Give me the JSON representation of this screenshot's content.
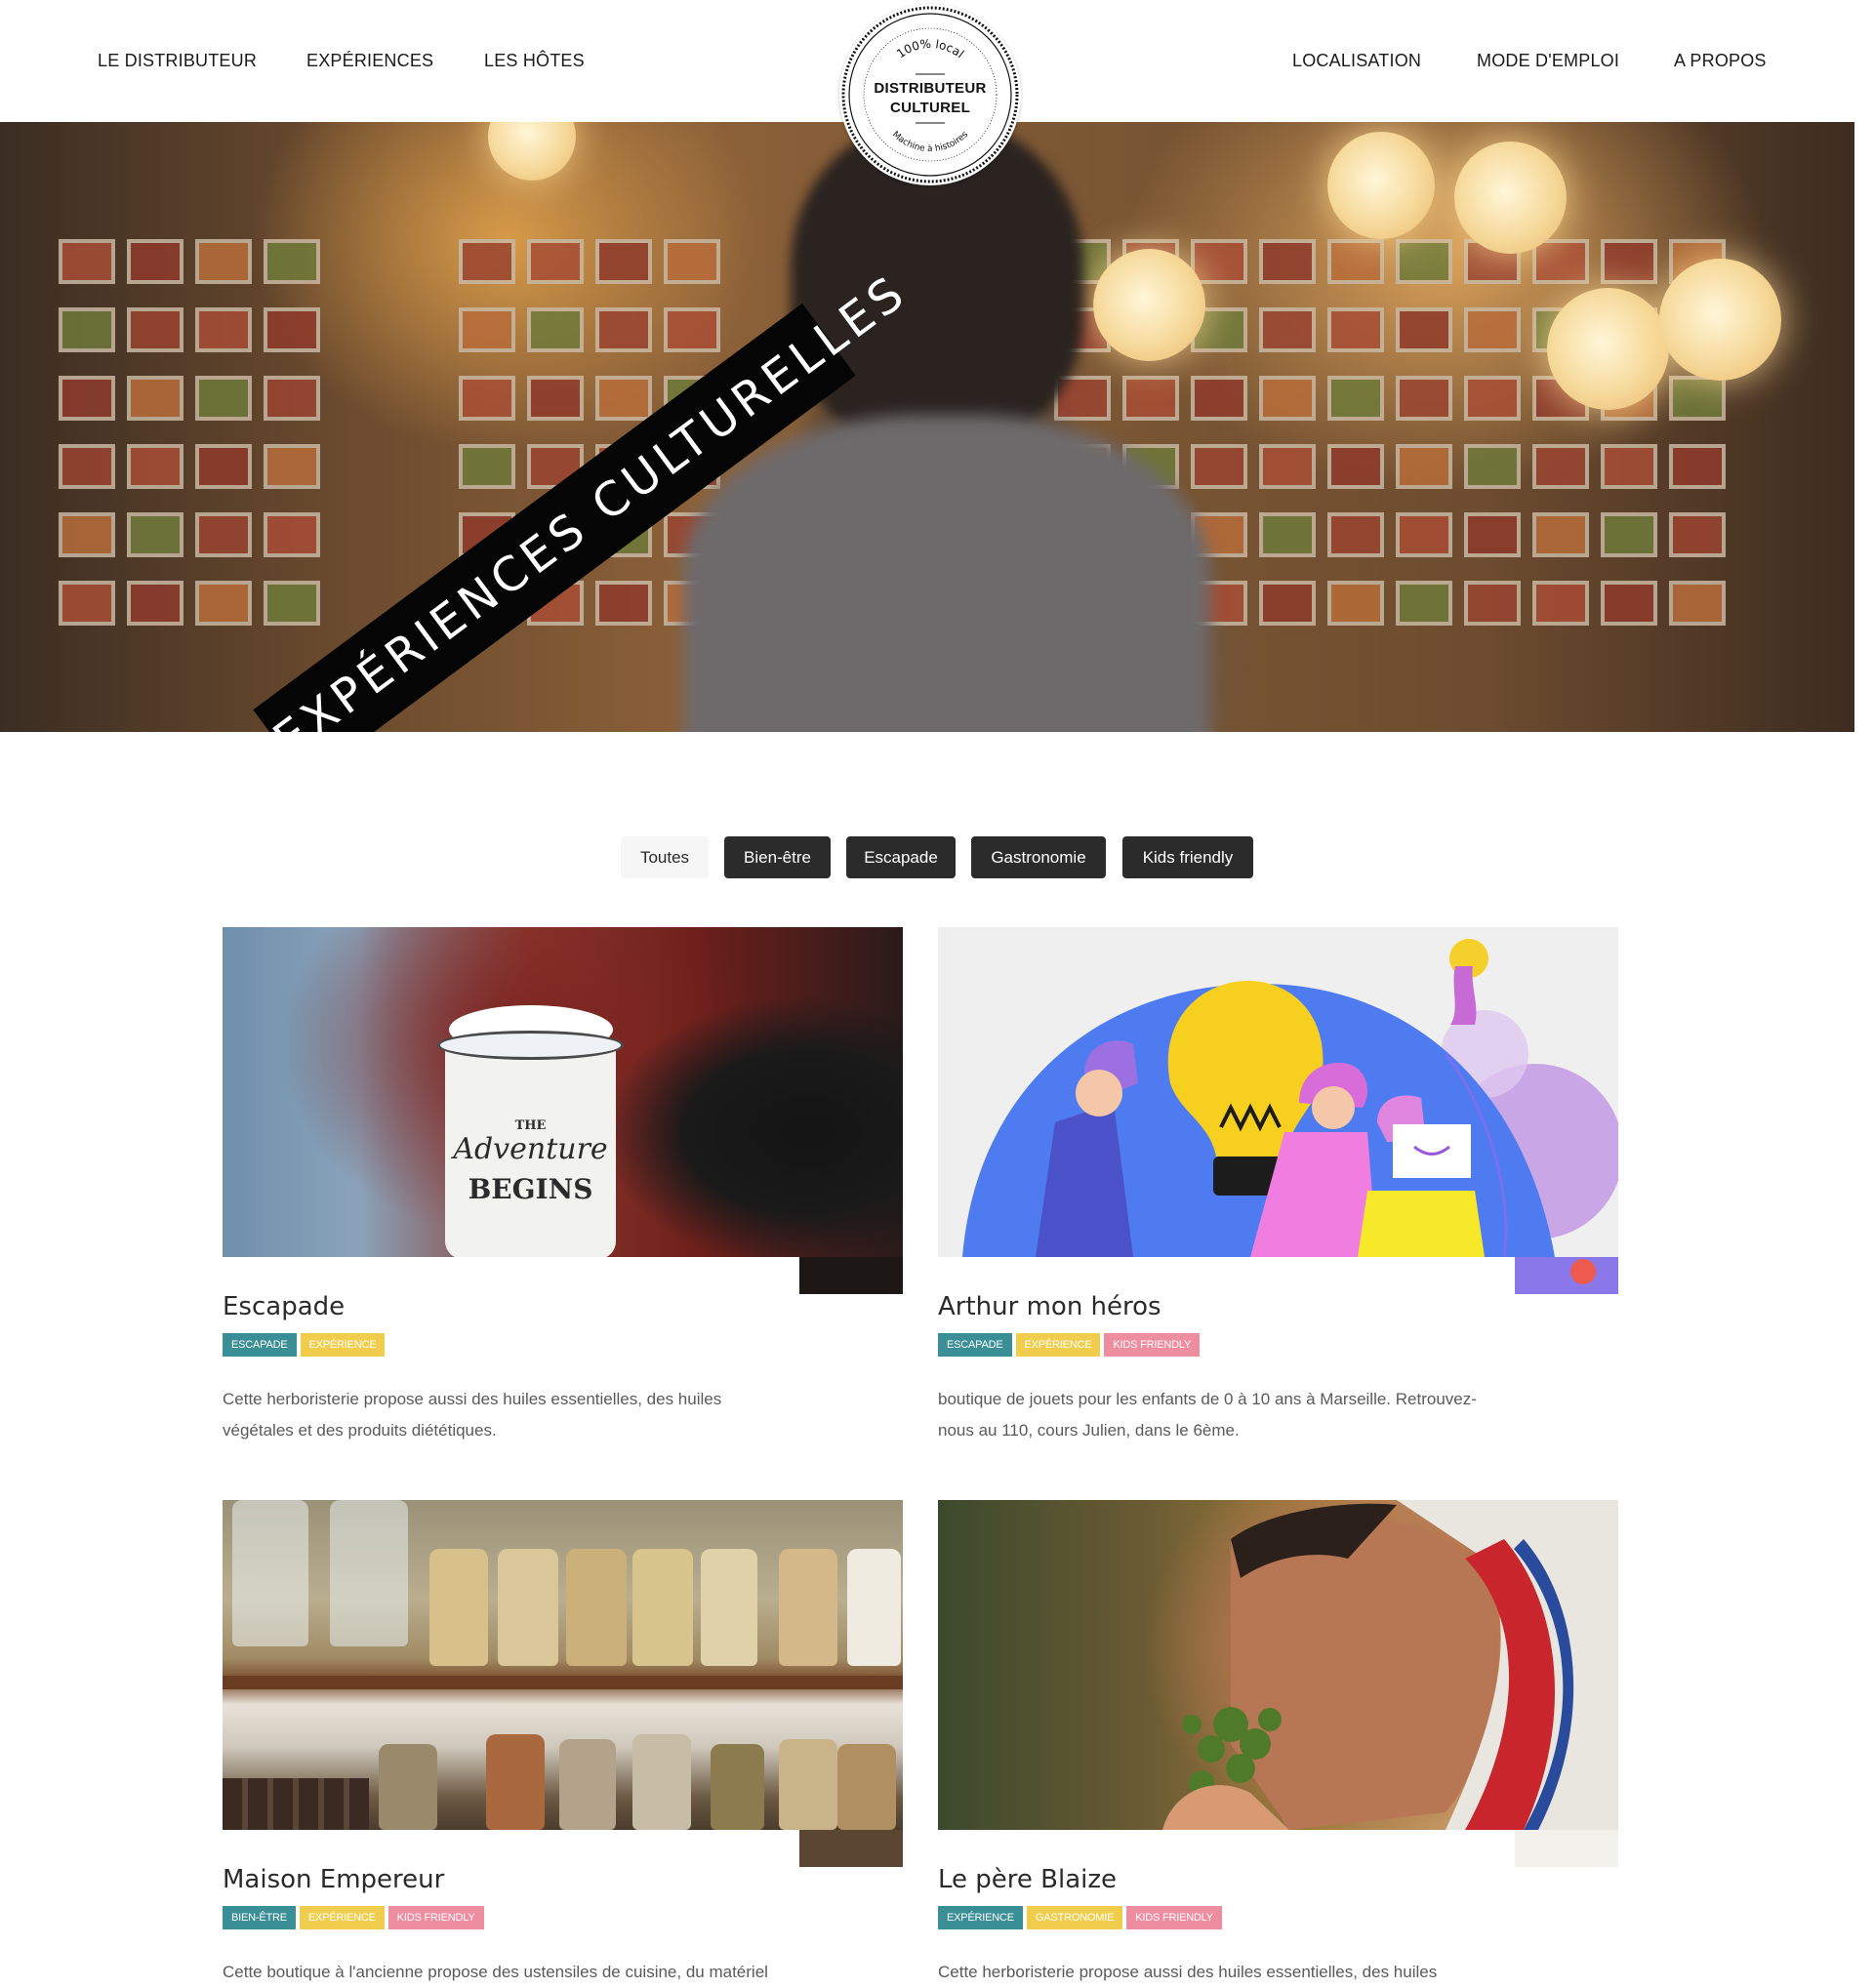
{
  "nav": {
    "left": [
      "LE DISTRIBUTEUR",
      "EXPÉRIENCES",
      "LES HÔTES"
    ],
    "right": [
      "LOCALISATION",
      "MODE D'EMPLOI",
      "A PROPOS"
    ]
  },
  "logo": {
    "top_arc": "100% local",
    "name_line1": "DISTRIBUTEUR",
    "name_line2": "CULTUREL",
    "bottom_arc": "Machine à histoires"
  },
  "hero": {
    "banner": "EXPÉRIENCES CULTURELLES"
  },
  "filters": [
    {
      "label": "Toutes",
      "active": false
    },
    {
      "label": "Bien-être",
      "active": true
    },
    {
      "label": "Escapade",
      "active": true
    },
    {
      "label": "Gastronomie",
      "active": true
    },
    {
      "label": "Kids friendly",
      "active": true
    }
  ],
  "cards": [
    {
      "title": "Escapade",
      "tags": [
        "ESCAPADE",
        "EXPÉRIENCE"
      ],
      "description": "Cette herboristerie propose aussi des huiles essentielles, des huiles végétales et des produits diététiques.",
      "image_alt": "mug",
      "mug_text": [
        "THE",
        "Adventure",
        "BEGINS"
      ]
    },
    {
      "title": "Arthur mon héros",
      "tags": [
        "ESCAPADE",
        "EXPÉRIENCE",
        "KIDS FRIENDLY"
      ],
      "description": "boutique de jouets pour les enfants de 0 à 10 ans à Marseille. Retrouvez-nous au 110, cours Julien, dans le 6ème.",
      "image_alt": "illustration"
    },
    {
      "title": "Maison Empereur",
      "tags": [
        "BIEN-ÊTRE",
        "EXPÉRIENCE",
        "KIDS FRIENDLY"
      ],
      "description": "Cette boutique à l'ancienne propose des ustensiles de cuisine, du matériel",
      "image_alt": "jars"
    },
    {
      "title": "Le père Blaize",
      "tags": [
        "EXPÉRIENCE",
        "GASTRONOMIE",
        "KIDS FRIENDLY"
      ],
      "description": "Cette herboristerie propose aussi des huiles essentielles, des huiles",
      "image_alt": "chef"
    }
  ],
  "colors": {
    "tag_teal": "#3a8f97",
    "tag_yellow": "#f0cd4c",
    "tag_pink": "#ef8da0",
    "filter_active": "#2b2b2b",
    "filter_inactive": "#f6f6f6"
  }
}
